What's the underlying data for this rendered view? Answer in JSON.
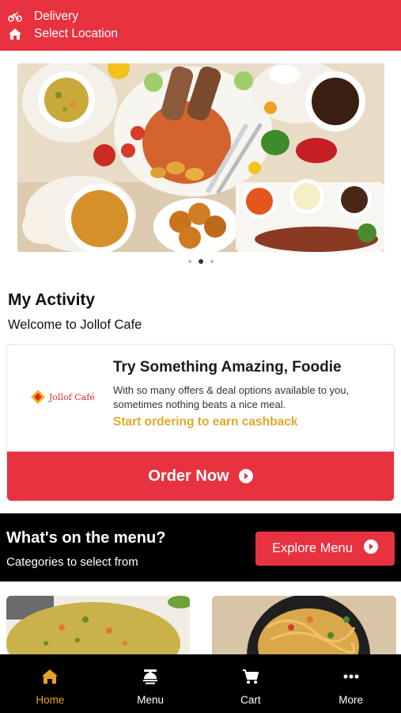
{
  "header": {
    "delivery_label": "Delivery",
    "location_label": "Select Location",
    "brand_color": "#e8323f"
  },
  "banner": {
    "slides": 3,
    "active_slide": 2
  },
  "activity": {
    "title": "My Activity",
    "welcome": "Welcome to Jollof Cafe"
  },
  "promo_card": {
    "logo_text": "Jollof Café",
    "title": "Try Something Amazing, Foodie",
    "description": "With so many offers & deal options available to you, sometimes nothing beats a nice meal.",
    "cta_text": "Start ordering to earn cashback",
    "cta_color": "#e3a72b",
    "order_button": "Order Now"
  },
  "menu_section": {
    "title": "What's on the menu?",
    "subtitle": "Categories to select from",
    "explore_button": "Explore Menu"
  },
  "bottom_nav": {
    "items": [
      {
        "label": "Home",
        "icon": "home-icon",
        "active": true
      },
      {
        "label": "Menu",
        "icon": "menu-dish-icon",
        "active": false
      },
      {
        "label": "Cart",
        "icon": "cart-icon",
        "active": false
      },
      {
        "label": "More",
        "icon": "more-dots-icon",
        "active": false
      }
    ],
    "active_color": "#e6a524"
  }
}
